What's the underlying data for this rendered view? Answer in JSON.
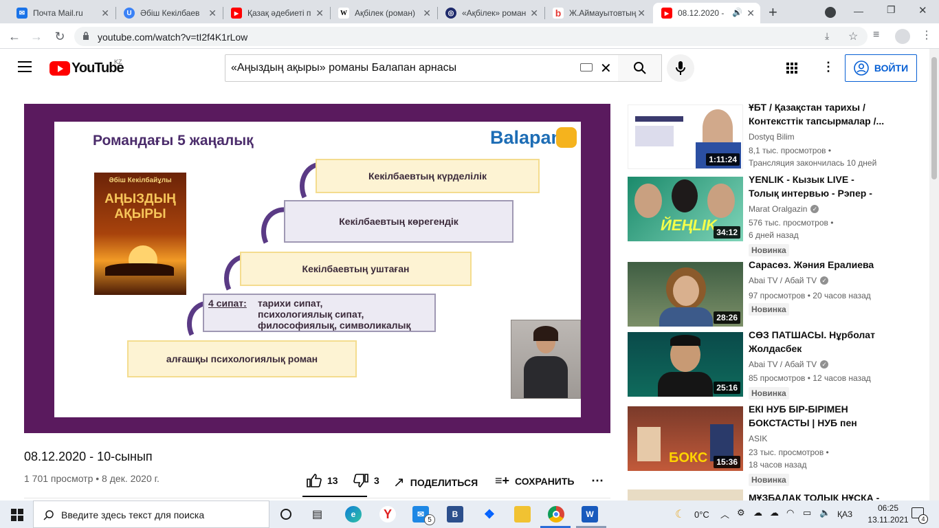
{
  "browser": {
    "tabs": [
      {
        "title": "Почта Mail.ru",
        "icon": "mail-icon",
        "color": "#1a73e8",
        "glyph": "✉"
      },
      {
        "title": "Әбіш Кекілбаев",
        "icon": "ucoz-icon",
        "color": "#3b82f6",
        "glyph": "U"
      },
      {
        "title": "Қазақ әдебиеті п",
        "icon": "youtube-icon",
        "color": "#ff0000",
        "glyph": "▶"
      },
      {
        "title": "Ақбілек (роман)",
        "icon": "wikipedia-icon",
        "color": "#ffffff",
        "glyph": "W"
      },
      {
        "title": "«Ақбілек» роман",
        "icon": "site-icon",
        "color": "#1e2a6b",
        "glyph": "◎"
      },
      {
        "title": "Ж.Аймауытовтың",
        "icon": "bilim-icon",
        "color": "#ffffff",
        "glyph": "b"
      },
      {
        "title": "08.12.2020 -",
        "icon": "youtube-icon",
        "color": "#ff0000",
        "glyph": "▶",
        "active": true
      }
    ],
    "url": "youtube.com/watch?v=tI2f4K1rLow"
  },
  "youtube": {
    "logo_text": "YouTube",
    "country": "KZ",
    "search_value": "«Аңыздың ақыры» романы Балапан арнасы",
    "signin_label": "ВОЙТИ"
  },
  "slide": {
    "heading": "Романдағы 5 жаңалық",
    "brand": "Balapan",
    "book_author": "Әбіш Кекілбайұлы",
    "book_title": "АҢЫЗДЫҢ АҚЫРЫ",
    "steps": [
      "Кекілбаевтың күрделілік",
      "Кекілбаевтың көрегендік",
      "Кекілбаевтың уштаған",
      "алғашқы психологиялық роман"
    ],
    "sipat_label": "4 сипат:",
    "sipat_lines": [
      "тарихи сипат,",
      "психологиялық сипат,",
      "философиялық, символикалық"
    ]
  },
  "video": {
    "title": "08.12.2020 - 10-сынып",
    "meta": "1 701 просмотр • 8 дек. 2020 г.",
    "likes": "13",
    "dislikes": "3",
    "share_label": "ПОДЕЛИТЬСЯ",
    "save_label": "СОХРАНИТЬ"
  },
  "recommendations": [
    {
      "title": "ҰБТ / Қазақстан тарихы / Контексттік тапсырмалар /...",
      "channel": "Dostyq Bilim",
      "verified": false,
      "views": "8,1 тыс. просмотров",
      "ago": "Трансляция закончилась 10 дней",
      "duration": "1:11:24",
      "badge": ""
    },
    {
      "title": "YENLIK - Кызык LIVE - Толық интервью - Рэпер - мұғалім -...",
      "channel": "Marat Oralgazin",
      "verified": true,
      "views": "576 тыс. просмотров",
      "ago": "6 дней назад",
      "duration": "34:12",
      "badge": "Новинка"
    },
    {
      "title": "Сарасөз. Жәния Ералиева",
      "channel": "Abai TV / Абай TV",
      "verified": true,
      "views": "97 просмотров",
      "ago": "20 часов назад",
      "duration": "28:26",
      "badge": "Новинка"
    },
    {
      "title": "СӨЗ ПАТШАСЫ. Нұрболат Жолдасбек",
      "channel": "Abai TV / Абай TV",
      "verified": true,
      "views": "85 просмотров",
      "ago": "12 часов назад",
      "duration": "25:16",
      "badge": "Новинка"
    },
    {
      "title": "ЕКІ НУБ БІР-БІРІМЕН БОКСТАСТЫ | НУБ пен ПРО...",
      "channel": "ASIK",
      "verified": false,
      "views": "23 тыс. просмотров",
      "ago": "18 часов назад",
      "duration": "15:36",
      "badge": "Новинка"
    },
    {
      "title": "МҰЗБАЛАҚ ТОЛЫҚ НҰСҚА -",
      "channel": "",
      "verified": false,
      "views": "",
      "ago": "",
      "duration": "",
      "badge": ""
    }
  ],
  "taskbar": {
    "search_placeholder": "Введите здесь текст для поиска",
    "temp": "0°C",
    "lang": "ҚАЗ",
    "time": "06:25",
    "date": "13.11.2021",
    "notifications": "4",
    "mail_badge": "5"
  }
}
